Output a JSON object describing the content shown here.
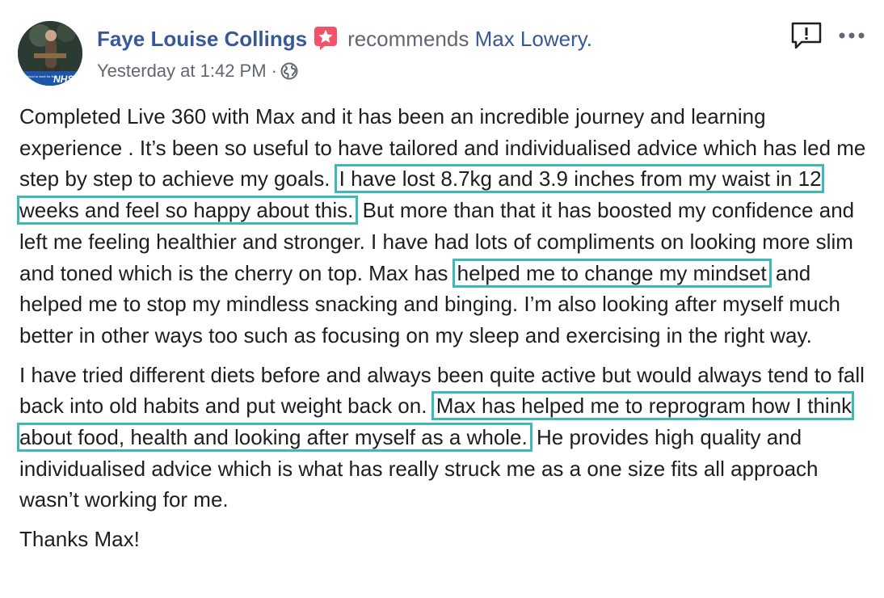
{
  "post": {
    "author": "Faye Louise Collings",
    "verb": "recommends",
    "target": "Max Lowery.",
    "timestamp": "Yesterday at 1:42 PM",
    "separator": "·",
    "privacy_icon": "globe-icon",
    "recommend_icon": "star-badge-icon",
    "avatar_badge_text": "NHS",
    "avatar_badge_small_text": "Proud to work for the",
    "header_icons": [
      "report-icon",
      "more-icon"
    ],
    "paragraph1": {
      "t1": "Completed Live 360 with Max and it has been an incredible journey and learning experience . It’s been so useful to have tailored and individualised advice which has led me step by step to achieve my goals.",
      "h1": "I have lost 8.7kg and 3.9 inches from my waist in 12 weeks and feel so happy about this.",
      "t2": "But more than that it has boosted my confidence and left me feeling healthier and stronger. I have had lots of compliments on looking more slim and toned which is the cherry on top. Max has",
      "h2": "helped me to change my mindset",
      "t3": "and helped me to stop my mindless snacking and binging. I’m also looking after myself much better in other ways too such as focusing on my sleep and exercising in the right way."
    },
    "paragraph2": {
      "t1": "I have tried different diets before and always been quite active but would always tend to fall back into old habits and put weight back on.",
      "h1": "Max has helped me to reprogram how I think about food, health and looking after myself as a whole.",
      "t2": "He provides high quality and individualised advice which is what has really struck me as a one size fits all approach wasn’t working for me."
    },
    "paragraph3": "Thanks Max!"
  },
  "colors": {
    "link": "#385898",
    "meta": "#606770",
    "text": "#1c1e21",
    "highlight": "#3dbab3",
    "badge": "#f35369"
  }
}
